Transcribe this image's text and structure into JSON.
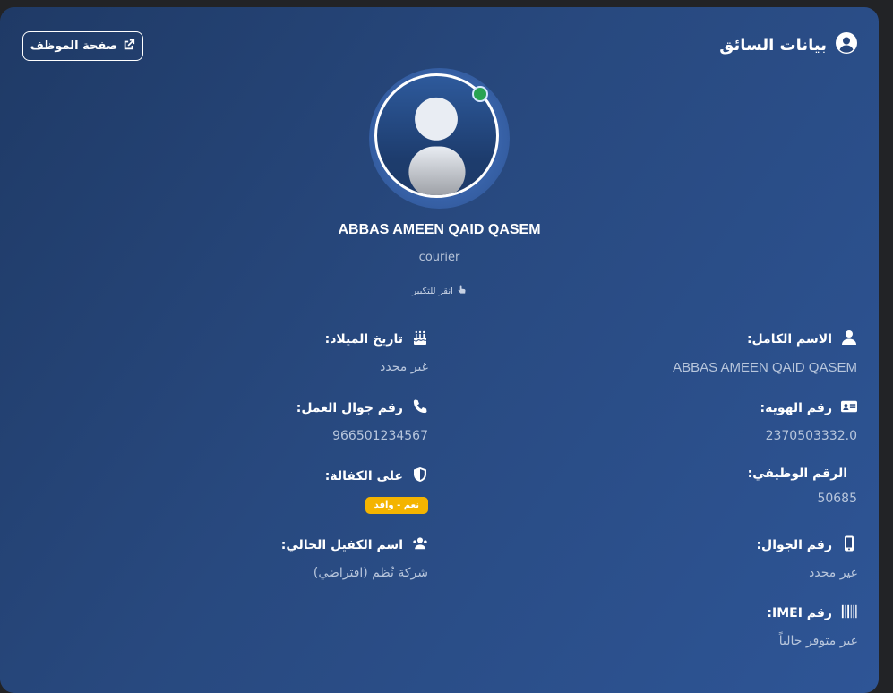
{
  "header": {
    "title": "بيانات السائق",
    "profile_button": "صفحة الموظف"
  },
  "profile": {
    "name": "ABBAS AMEEN QAID QASEM",
    "role": "courier",
    "zoom_hint": "انقر للتكبير"
  },
  "fields_right": [
    {
      "label": "الاسم الكامل:",
      "value": "ABBAS AMEEN QAID QASEM",
      "icon": "user-icon"
    },
    {
      "label": "رقم الهوية:",
      "value": "2370503332.0",
      "icon": "id-card-icon"
    },
    {
      "label": "الرقم الوظيفي:",
      "value": "50685",
      "icon": ""
    },
    {
      "label": "رقم الجوال:",
      "value": "غير محدد",
      "icon": "mobile-icon"
    },
    {
      "label": "رقم IMEI:",
      "value": "غير متوفر حالياً",
      "icon": "barcode-icon"
    }
  ],
  "fields_left": [
    {
      "label": "تاريخ الميلاد:",
      "value": "غير محدد",
      "icon": "birthday-cake-icon"
    },
    {
      "label": "رقم جوال العمل:",
      "value": "966501234567",
      "icon": "phone-icon"
    },
    {
      "label": "على الكفالة:",
      "badge": "نعم - وافد",
      "icon": "shield-icon"
    },
    {
      "label": "اسم الكفيل الحالي:",
      "value": "شركة نُظم (افتراضي)",
      "icon": "users-icon"
    }
  ],
  "colors": {
    "badge": "#f4b400",
    "online": "#29a352",
    "card": "#28497f"
  }
}
